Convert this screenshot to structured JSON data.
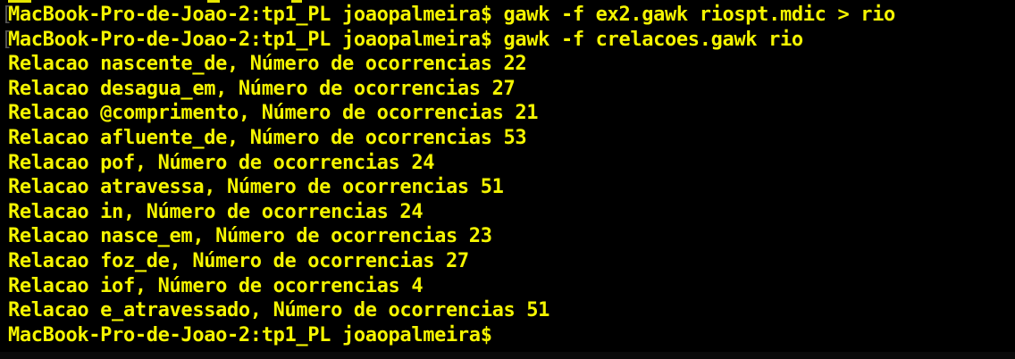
{
  "terminal": {
    "colors": {
      "background": "#000000",
      "text": "#f5f500",
      "bracket": "#555555"
    },
    "lines": [
      {
        "text": "MacBook-Pro-de-Joao-2:tp1_PL joaopalmeira$ gawk -f ex2.gawk riospt.mdic > rio",
        "bracket": "["
      },
      {
        "text": "MacBook-Pro-de-Joao-2:tp1_PL joaopalmeira$ gawk -f crelacoes.gawk rio",
        "bracket": "["
      },
      {
        "text": "Relacao nascente_de, Número de ocorrencias 22"
      },
      {
        "text": "Relacao desagua_em, Número de ocorrencias 27"
      },
      {
        "text": "Relacao @comprimento, Número de ocorrencias 21"
      },
      {
        "text": "Relacao afluente_de, Número de ocorrencias 53"
      },
      {
        "text": "Relacao pof, Número de ocorrencias 24"
      },
      {
        "text": "Relacao atravessa, Número de ocorrencias 51"
      },
      {
        "text": "Relacao in, Número de ocorrencias 24"
      },
      {
        "text": "Relacao nasce_em, Número de ocorrencias 23"
      },
      {
        "text": "Relacao foz_de, Número de ocorrencias 27"
      },
      {
        "text": "Relacao iof, Número de ocorrencias 4"
      },
      {
        "text": "Relacao e_atravessado, Número de ocorrencias 51"
      },
      {
        "text": "MacBook-Pro-de-Joao-2:tp1_PL joaopalmeira$"
      }
    ]
  }
}
